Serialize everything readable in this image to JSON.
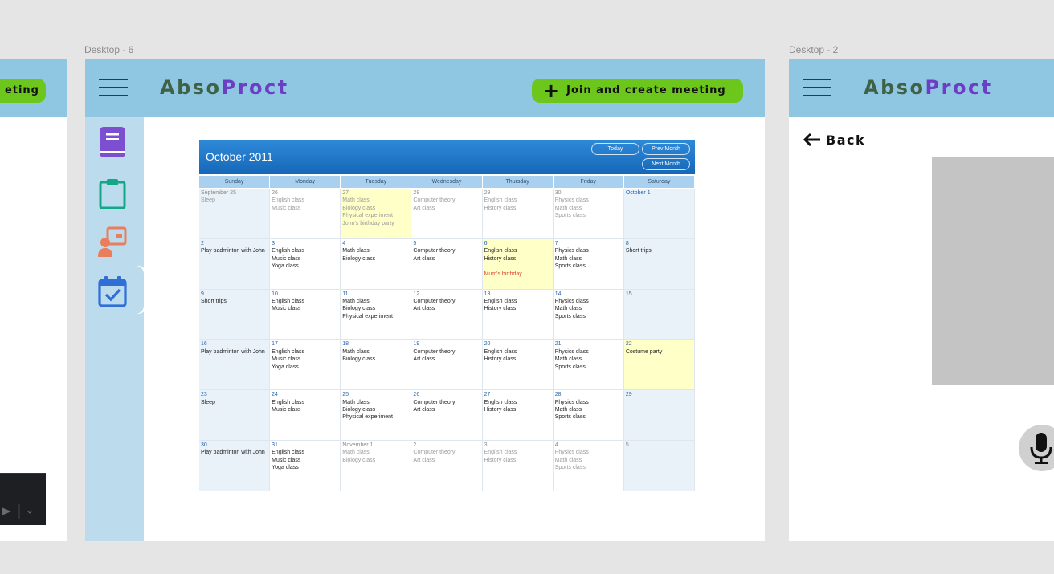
{
  "frames": {
    "left_label": "",
    "center_label": "Desktop - 6",
    "right_label": "Desktop - 2"
  },
  "brand": {
    "part1": "Abso",
    "part2": "Proct"
  },
  "left_frame": {
    "button_label": "eting"
  },
  "header": {
    "join_label": "Join and create meeting"
  },
  "sidebar": {
    "items": [
      {
        "icon": "book-icon",
        "color": "#7b4fd0"
      },
      {
        "icon": "clipboard-icon",
        "color": "#11a888"
      },
      {
        "icon": "user-board-icon",
        "color": "#ea7d5b"
      },
      {
        "icon": "calendar-check-icon",
        "color": "#2f6fd6",
        "active": true
      }
    ]
  },
  "calendar": {
    "title": "October 2011",
    "buttons": {
      "today": "Today",
      "prev": "Prev Month",
      "next": "Next Month"
    },
    "weekdays": [
      "Sunday",
      "Monday",
      "Tuesday",
      "Wednesday",
      "Thursday",
      "Friday",
      "Saturday"
    ],
    "weeks": [
      [
        {
          "date": "September 25",
          "events": [
            "Sleep"
          ],
          "other": true
        },
        {
          "date": "26",
          "events": [
            "English class",
            "Music class"
          ],
          "other": true
        },
        {
          "date": "27",
          "events": [
            "Math class",
            "Biology class",
            "Physical experiment",
            "John's birthday party"
          ],
          "other": true,
          "highlight": true
        },
        {
          "date": "28",
          "events": [
            "Computer theory",
            "Art class"
          ],
          "other": true
        },
        {
          "date": "29",
          "events": [
            "English class",
            "History class"
          ],
          "other": true
        },
        {
          "date": "30",
          "events": [
            "Physics class",
            "Math class",
            "Sports class"
          ],
          "other": true
        },
        {
          "date": "October 1",
          "events": []
        }
      ],
      [
        {
          "date": "2",
          "events": [
            "Play badminton with John"
          ]
        },
        {
          "date": "3",
          "events": [
            "English class",
            "Music class",
            "Yoga class"
          ]
        },
        {
          "date": "4",
          "events": [
            "Math class",
            "Biology class"
          ]
        },
        {
          "date": "5",
          "events": [
            "Computer theory",
            "Art class"
          ]
        },
        {
          "date": "6",
          "events": [
            "English class",
            "History class"
          ],
          "special": "Mum's birthday",
          "highlight": true
        },
        {
          "date": "7",
          "events": [
            "Physics class",
            "Math class",
            "Sports class"
          ]
        },
        {
          "date": "8",
          "events": [
            "Short trips"
          ]
        }
      ],
      [
        {
          "date": "9",
          "events": [
            "Short trips"
          ]
        },
        {
          "date": "10",
          "events": [
            "English class",
            "Music class"
          ]
        },
        {
          "date": "11",
          "events": [
            "Math class",
            "Biology class",
            "Physical experiment"
          ]
        },
        {
          "date": "12",
          "events": [
            "Computer theory",
            "Art class"
          ]
        },
        {
          "date": "13",
          "events": [
            "English class",
            "History class"
          ]
        },
        {
          "date": "14",
          "events": [
            "Physics class",
            "Math class",
            "Sports class"
          ]
        },
        {
          "date": "15",
          "events": []
        }
      ],
      [
        {
          "date": "16",
          "events": [
            "Play badminton with John"
          ]
        },
        {
          "date": "17",
          "events": [
            "English class",
            "Music class",
            "Yoga class"
          ]
        },
        {
          "date": "18",
          "events": [
            "Math class",
            "Biology class"
          ]
        },
        {
          "date": "19",
          "events": [
            "Computer theory",
            "Art class"
          ]
        },
        {
          "date": "20",
          "events": [
            "English class",
            "History class"
          ]
        },
        {
          "date": "21",
          "events": [
            "Physics class",
            "Math class",
            "Sports class"
          ]
        },
        {
          "date": "22",
          "events": [
            "Costume party"
          ],
          "highlight": true
        }
      ],
      [
        {
          "date": "23",
          "events": [
            "Sleep"
          ]
        },
        {
          "date": "24",
          "events": [
            "English class",
            "Music class"
          ]
        },
        {
          "date": "25",
          "events": [
            "Math class",
            "Biology class",
            "Physical experiment"
          ]
        },
        {
          "date": "26",
          "events": [
            "Computer theory",
            "Art class"
          ]
        },
        {
          "date": "27",
          "events": [
            "English class",
            "History class"
          ]
        },
        {
          "date": "28",
          "events": [
            "Physics class",
            "Math class",
            "Sports class"
          ]
        },
        {
          "date": "29",
          "events": []
        }
      ],
      [
        {
          "date": "30",
          "events": [
            "Play badminton with John"
          ]
        },
        {
          "date": "31",
          "events": [
            "English class",
            "Music class",
            "Yoga class"
          ]
        },
        {
          "date": "November 1",
          "events": [
            "Math class",
            "Biology class"
          ],
          "other": true
        },
        {
          "date": "2",
          "events": [
            "Computer theory",
            "Art class"
          ],
          "other": true
        },
        {
          "date": "3",
          "events": [
            "English class",
            "History class"
          ],
          "other": true
        },
        {
          "date": "4",
          "events": [
            "Physics class",
            "Math class",
            "Sports class"
          ],
          "other": true
        },
        {
          "date": "5",
          "events": [],
          "other": true
        }
      ]
    ]
  },
  "right_frame": {
    "back_label": "Back"
  },
  "colors": {
    "topbar": "#8fc7e3",
    "sidebar": "#bcdcee",
    "join_button": "#6cc61c",
    "brand_dark": "#3f6247",
    "brand_purple": "#6c3ec4"
  }
}
